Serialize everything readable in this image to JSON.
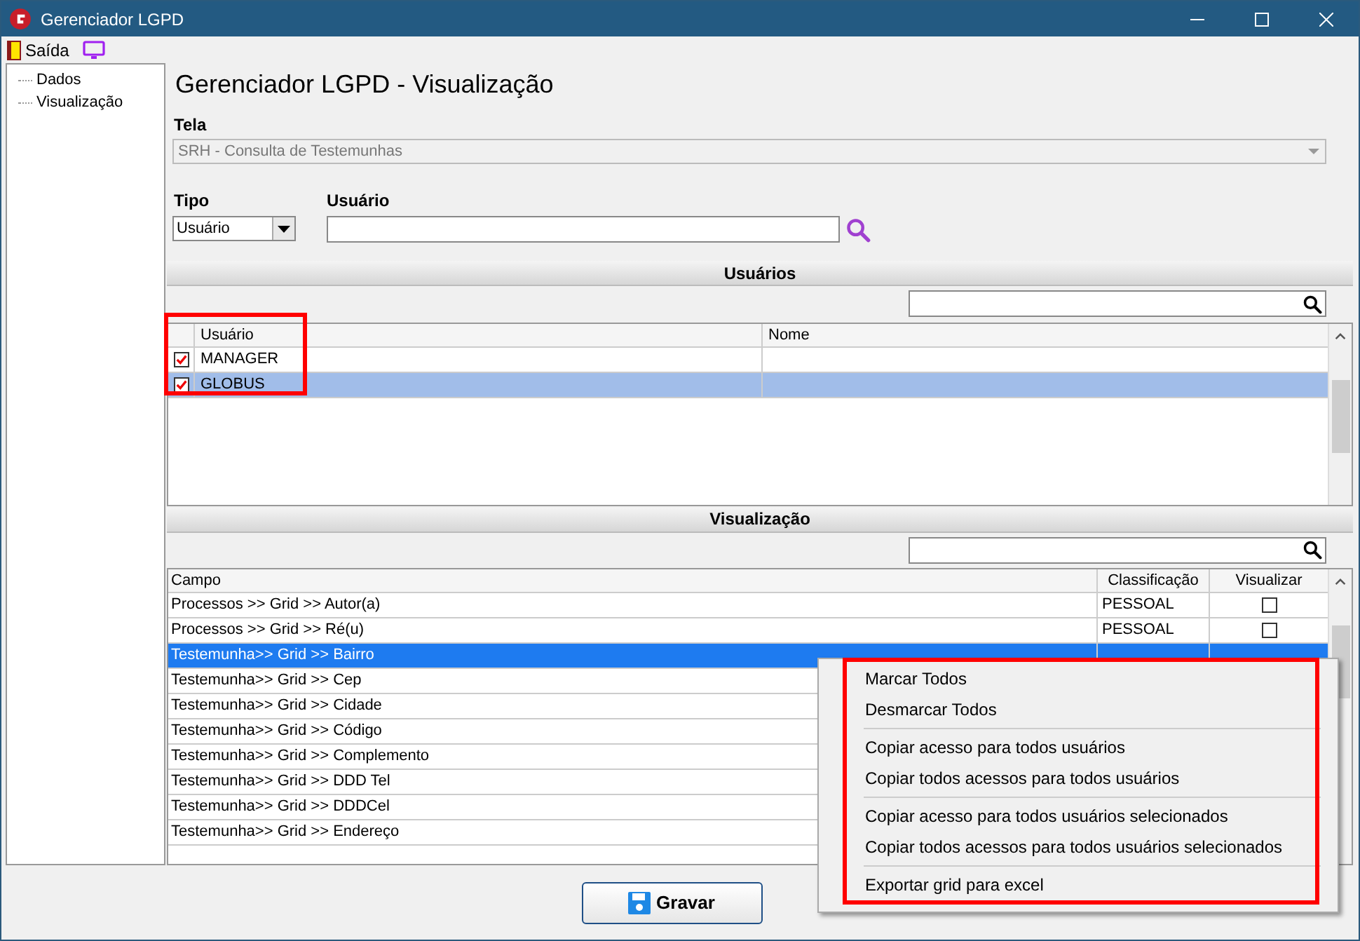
{
  "window": {
    "title": "Gerenciador LGPD"
  },
  "menubar": [
    {
      "label": "Saída",
      "kind": "exit"
    },
    {
      "kind": "screen"
    }
  ],
  "tree": [
    {
      "label": "Dados",
      "selected": false
    },
    {
      "label": "Visualização",
      "selected": false
    }
  ],
  "heading": "Gerenciador LGPD - Visualização",
  "tela": {
    "label": "Tela",
    "value": "SRH - Consulta de Testemunhas",
    "disabled": true
  },
  "tipo": {
    "label": "Tipo",
    "value": "Usuário"
  },
  "usuario": {
    "label": "Usuário"
  },
  "usuarios_section": {
    "title": "Usuários",
    "columns": [
      "Usuário",
      "Nome"
    ],
    "rows": [
      {
        "usuario": "MANAGER",
        "checked": true,
        "selected": false
      },
      {
        "usuario": "GLOBUS",
        "checked": true,
        "selected": true
      }
    ],
    "highlighted": true
  },
  "visualizacao_section": {
    "title": "Visualização",
    "columns": [
      "Campo",
      "Classificação",
      "Visualizar"
    ],
    "rows": [
      {
        "campo": "Processos >> Grid >> Autor(a)",
        "classificacao": "PESSOAL",
        "visualizar": false,
        "selected": false
      },
      {
        "campo": "Processos >> Grid >> Ré(u)",
        "classificacao": "PESSOAL",
        "visualizar": false,
        "selected": false
      },
      {
        "campo": "Testemunha>> Grid >> Bairro",
        "selected": true
      },
      {
        "campo": "Testemunha>> Grid >> Cep",
        "selected": false
      },
      {
        "campo": "Testemunha>> Grid >> Cidade",
        "selected": false
      },
      {
        "campo": "Testemunha>> Grid >> Código",
        "selected": false
      },
      {
        "campo": "Testemunha>> Grid >> Complemento",
        "selected": false
      },
      {
        "campo": "Testemunha>> Grid >> DDD Tel",
        "selected": false
      },
      {
        "campo": "Testemunha>> Grid >> DDDCel",
        "selected": false
      },
      {
        "campo": "Testemunha>> Grid >> Endereço",
        "selected": false
      }
    ]
  },
  "save_button": {
    "label": "Gravar"
  },
  "context_menu": {
    "highlighted": true,
    "groups": [
      [
        "Marcar Todos",
        "Desmarcar Todos"
      ],
      [
        "Copiar acesso para todos usuários",
        "Copiar todos acessos para todos usuários"
      ],
      [
        "Copiar acesso para todos usuários selecionados",
        "Copiar todos acessos para todos usuários selecionados"
      ],
      [
        "Exportar grid para excel"
      ]
    ]
  }
}
